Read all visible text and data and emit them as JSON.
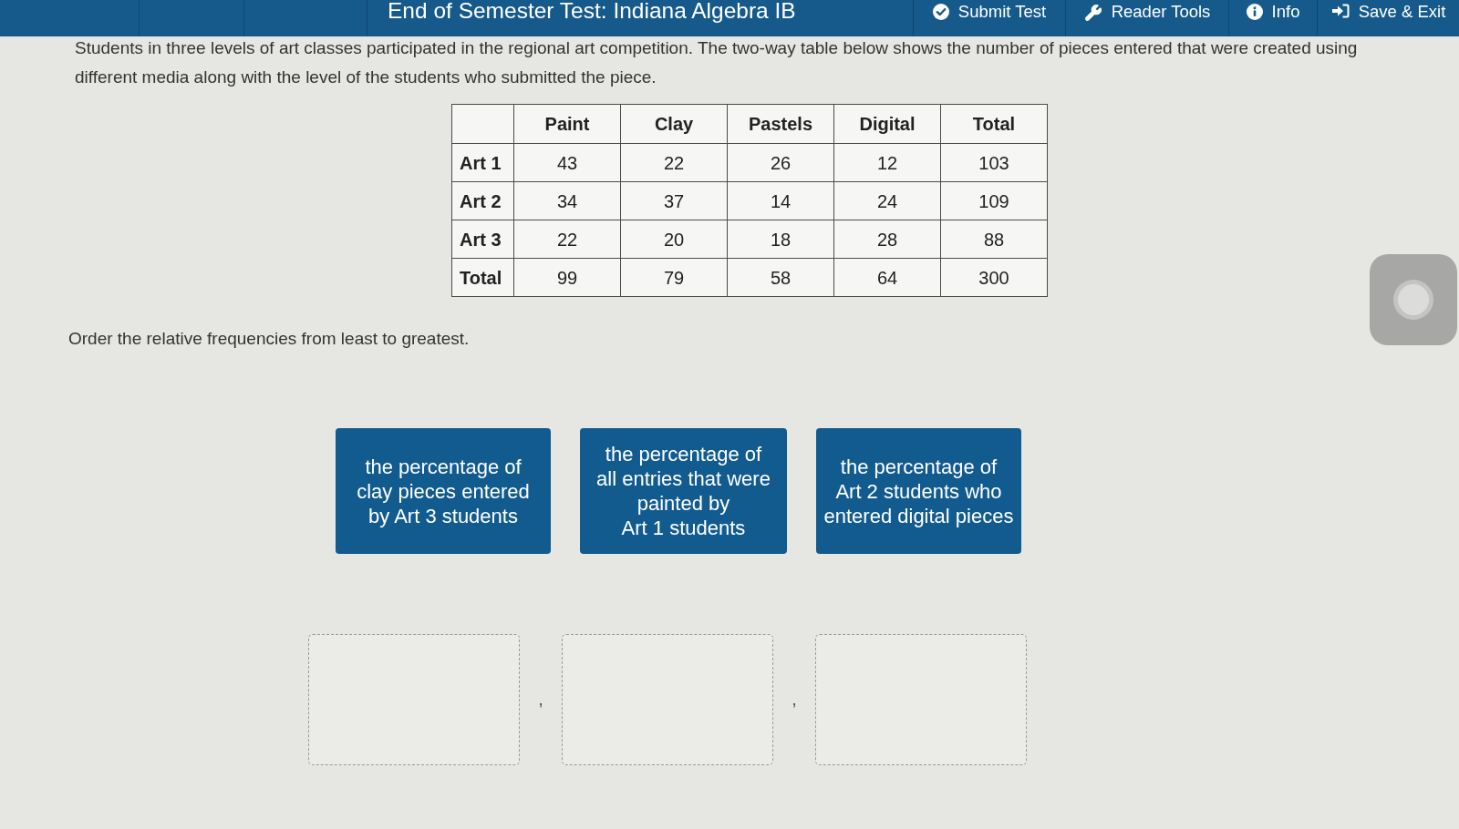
{
  "header": {
    "title": "End of Semester Test: Indiana Algebra IB",
    "actions": [
      {
        "label": "Submit Test",
        "kind": "submit"
      },
      {
        "label": "Reader Tools",
        "kind": "tools"
      },
      {
        "label": "Info",
        "kind": "info"
      },
      {
        "label": "Save & Exit",
        "kind": "exit"
      }
    ]
  },
  "passage": "Students in three levels of art classes participated in the regional art competition. The two-way table below shows the number of pieces entered that were created using different media along with the level of the students who submitted the piece.",
  "table": {
    "columns": [
      "Paint",
      "Clay",
      "Pastels",
      "Digital",
      "Total"
    ],
    "rows": [
      {
        "label": "Art 1",
        "cells": [
          "43",
          "22",
          "26",
          "12",
          "103"
        ]
      },
      {
        "label": "Art 2",
        "cells": [
          "34",
          "37",
          "14",
          "24",
          "109"
        ]
      },
      {
        "label": "Art 3",
        "cells": [
          "22",
          "20",
          "18",
          "28",
          "88"
        ]
      },
      {
        "label": "Total",
        "cells": [
          "99",
          "79",
          "58",
          "64",
          "300"
        ]
      }
    ]
  },
  "instruction": "Order the relative frequencies from least to greatest.",
  "choices": [
    {
      "lines": [
        "the percentage of",
        "clay pieces entered",
        "by Art 3 students"
      ]
    },
    {
      "lines": [
        "the percentage of",
        "all entries that were",
        "painted by",
        "Art 1 students"
      ]
    },
    {
      "lines": [
        "the percentage of",
        "Art 2 students who",
        "entered digital pieces"
      ]
    }
  ],
  "answer_row": [
    {
      "kind": "slot"
    },
    {
      "kind": "separator",
      "text": ","
    },
    {
      "kind": "slot"
    },
    {
      "kind": "separator",
      "text": ","
    },
    {
      "kind": "slot"
    }
  ]
}
